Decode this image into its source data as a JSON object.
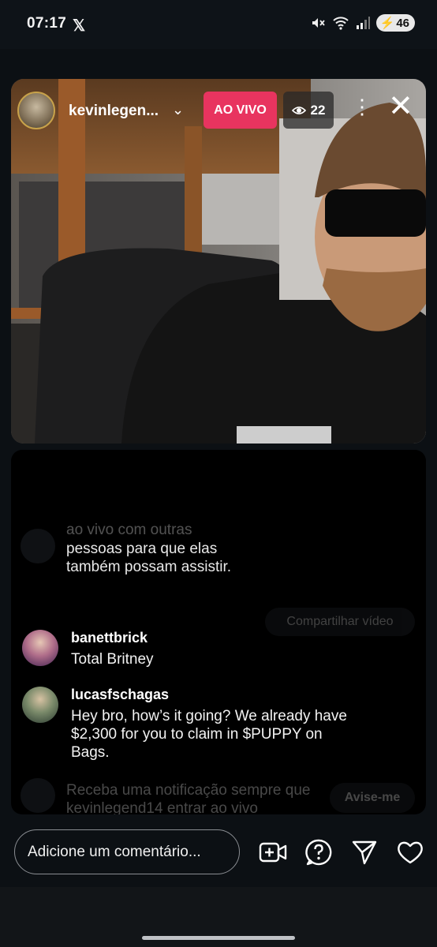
{
  "status_bar": {
    "time": "07:17",
    "app_icon": "x-logo-icon",
    "battery": "46"
  },
  "live": {
    "username": "kevinlegen...",
    "badge": "AO VIVO",
    "viewer_count": "22",
    "badge_color": "#e8345f"
  },
  "chat": {
    "share_text_top": "ao vivo com outras",
    "share_text": "pessoas para que elas também possam assistir.",
    "share_button": "Compartilhar vídeo",
    "comments": [
      {
        "user": "banettbrick",
        "text": "Total Britney"
      },
      {
        "user": "lucasfschagas",
        "text": "Hey bro, how’s it going? We already have $2,300 for you to claim in $PUPPY on Bags."
      }
    ],
    "notify_text": "Receba uma notificação sempre que kevinlegend14 entrar ao vivo",
    "notify_button": "Avise-me"
  },
  "bottom_bar": {
    "comment_placeholder": "Adicione um comentário..."
  }
}
